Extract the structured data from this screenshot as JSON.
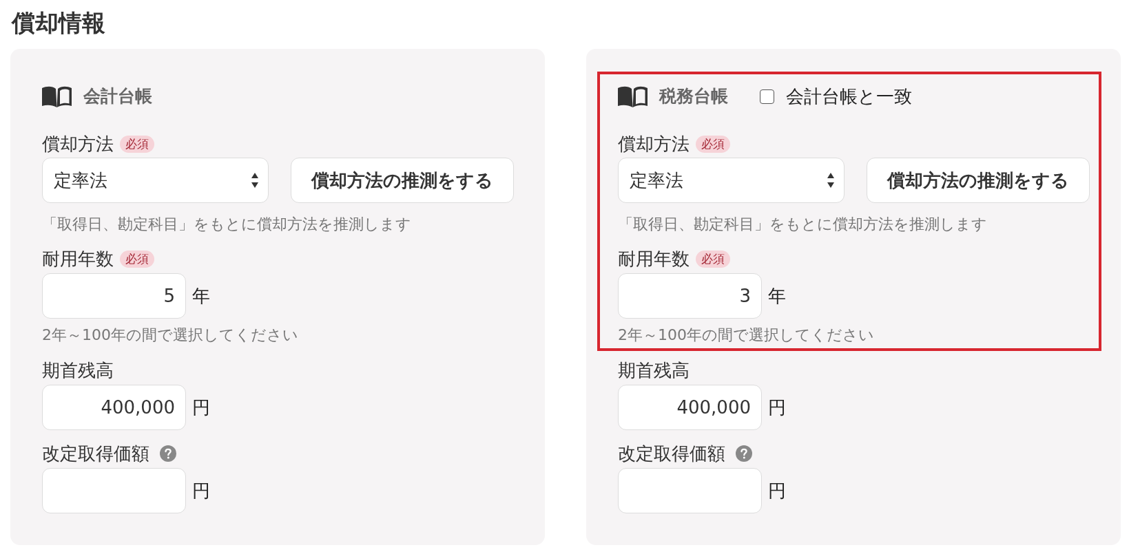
{
  "page_title": "償却情報",
  "ledgers": [
    {
      "title": "会計台帳",
      "highlighted": false,
      "depreciation_fields": [
        {
          "kind": "select",
          "label": "償却方法",
          "badge": "必須",
          "value": "定率法",
          "button": "償却方法の推測をする",
          "hint": "「取得日、勘定科目」をもとに償却方法を推測します"
        },
        {
          "kind": "number",
          "label": "耐用年数",
          "badge": "必須",
          "value": "5",
          "unit": "年",
          "hint": "2年～100年の間で選択してください"
        }
      ],
      "amount_fields": [
        {
          "kind": "number",
          "label": "期首残高",
          "value": "400,000",
          "unit": "円"
        },
        {
          "kind": "number",
          "label": "改定取得価額",
          "help_icon": true,
          "unit": "円"
        }
      ]
    },
    {
      "title": "税務台帳",
      "highlighted": true,
      "match_checkbox": {
        "label": "会計台帳と一致",
        "checked": false
      },
      "depreciation_fields": [
        {
          "kind": "select",
          "label": "償却方法",
          "badge": "必須",
          "value": "定率法",
          "button": "償却方法の推測をする",
          "hint": "「取得日、勘定科目」をもとに償却方法を推測します"
        },
        {
          "kind": "number",
          "label": "耐用年数",
          "badge": "必須",
          "value": "3",
          "unit": "年",
          "hint": "2年～100年の間で選択してください"
        }
      ],
      "amount_fields": [
        {
          "kind": "number",
          "label": "期首残高",
          "value": "400,000",
          "unit": "円"
        },
        {
          "kind": "number",
          "label": "改定取得価額",
          "help_icon": true,
          "unit": "円"
        }
      ]
    }
  ]
}
